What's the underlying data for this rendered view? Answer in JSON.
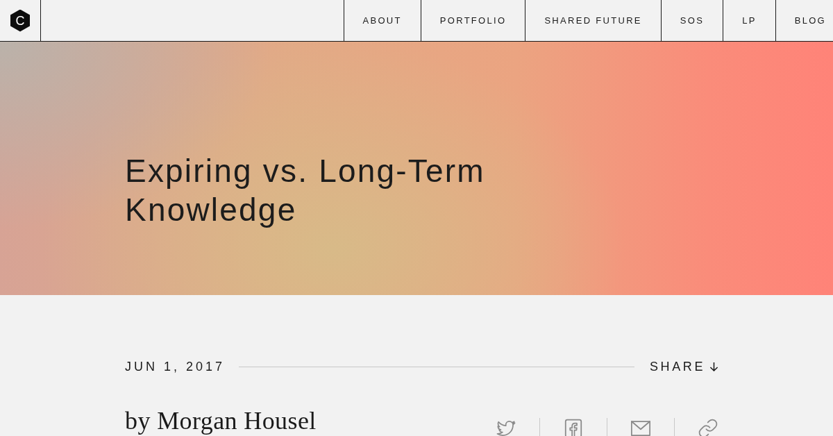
{
  "header": {
    "logo": "C",
    "nav": [
      "ABOUT",
      "PORTFOLIO",
      "SHARED FUTURE",
      "SOS",
      "LP",
      "BLOG"
    ]
  },
  "hero": {
    "title": "Expiring vs. Long-Term Knowledge"
  },
  "meta": {
    "date": "JUN 1, 2017",
    "share": "SHARE"
  },
  "byline": "by Morgan Housel"
}
